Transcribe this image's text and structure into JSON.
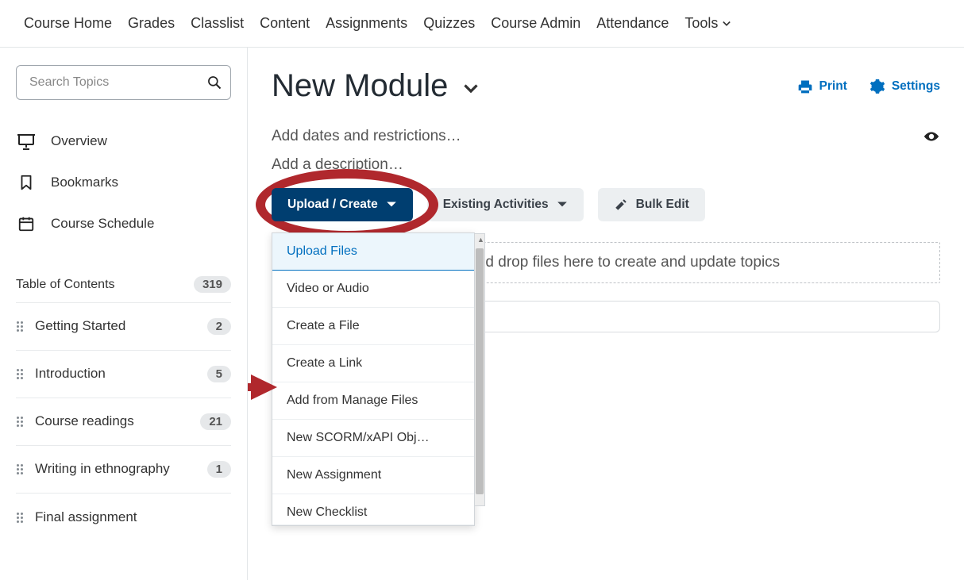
{
  "topnav": {
    "items": [
      "Course Home",
      "Grades",
      "Classlist",
      "Content",
      "Assignments",
      "Quizzes",
      "Course Admin",
      "Attendance"
    ],
    "tools_label": "Tools"
  },
  "sidebar": {
    "search_placeholder": "Search Topics",
    "nav": {
      "overview": "Overview",
      "bookmarks": "Bookmarks",
      "course_schedule": "Course Schedule"
    },
    "toc_label": "Table of Contents",
    "toc_count": "319",
    "toc_items": [
      {
        "label": "Getting Started",
        "count": "2"
      },
      {
        "label": "Introduction",
        "count": "5"
      },
      {
        "label": "Course readings",
        "count": "21"
      },
      {
        "label": "Writing in ethnography",
        "count": "1"
      },
      {
        "label": "Final assignment",
        "count": ""
      }
    ]
  },
  "main": {
    "title": "New Module",
    "print_label": "Print",
    "settings_label": "Settings",
    "add_dates_label": "Add dates and restrictions…",
    "add_description_label": "Add a description…",
    "buttons": {
      "upload_create": "Upload / Create",
      "existing_activities": "Existing Activities",
      "bulk_edit": "Bulk Edit"
    },
    "dropdown": [
      "Upload Files",
      "Video or Audio",
      "Create a File",
      "Create a Link",
      "Add from Manage Files",
      "New SCORM/xAPI Obj…",
      "New Assignment",
      "New Checklist"
    ],
    "dropzone_text": "Drag and drop files here to create and update topics"
  }
}
